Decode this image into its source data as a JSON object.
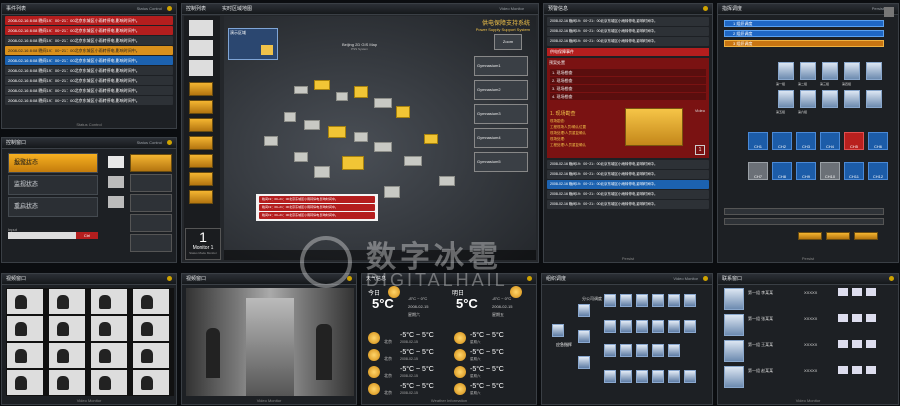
{
  "watermark": {
    "title": "数字冰雹",
    "subtitle": "DIGITALHAIL"
  },
  "alarm_panel": {
    "title": "事件列表",
    "sub": "Status Control",
    "footer": "Status Control",
    "rows": [
      {
        "text": "2008-02-16  8:08  晚间19：00~21：00北京东城区小雨转停电,影响时间中。",
        "style": "red"
      },
      {
        "text": "2008-02-16  8:08  晚间19：00~21：00北京东城区小雨转停电,影响时间中。",
        "style": "red"
      },
      {
        "text": "2008-02-16  8:08  晚间19：00~21：00北京东城区小雨转停电,影响时间中。",
        "style": "gray"
      },
      {
        "text": "2008-02-16  8:08  晚间19：00~21：00北京东城区小雨转停电,影响时间中。",
        "style": "orange"
      },
      {
        "text": "2008-02-16  8:08  晚间19：00~21：00北京东城区小雨转停电,影响时间中。",
        "style": "blue"
      },
      {
        "text": "2008-02-16  8:08  晚间19：00~21：00北京东城区小雨转停电,影响时间中。",
        "style": "gray"
      },
      {
        "text": "2008-02-16  8:08  晚间19：00~21：00北京东城区小雨转停电,影响时间中。",
        "style": "gray"
      },
      {
        "text": "2008-02-16  8:08  晚间19：00~21：00北京东城区小雨转停电,影响时间中。",
        "style": "gray"
      },
      {
        "text": "2008-02-16  8:08  晚间19：00~21：00北京东城区小雨转停电,影响时间中。",
        "style": "gray"
      }
    ]
  },
  "control_panel": {
    "title": "控制窗口",
    "sub": "Status Control",
    "footer": "Status Control",
    "states": [
      {
        "label": "报警状态",
        "sub": "Alarm Status"
      },
      {
        "label": "监视状态",
        "sub": "Camera Status"
      },
      {
        "label": "重启状态",
        "sub": "System Status"
      }
    ],
    "input_label": "Input",
    "input_value": "Ctrl"
  },
  "map_panel": {
    "title": "控制列表",
    "monitor_number": "1",
    "monitor_label": "Monitor 1",
    "monitor_sub": "Status Mode Monitor",
    "main_title": "供电保障支持系统",
    "main_sub": "Power Supply Support System",
    "header_left": "实时区域地图",
    "mini_label": "演示区域",
    "city_label": "Beijing 2D GIS Map",
    "city_sub": "PSS System",
    "zoom": "Zoom",
    "venues": [
      "Gymnasium1",
      "Gymnasium2",
      "Gymnasium3",
      "Gymnasium4",
      "Gymnasium5"
    ],
    "ticker": [
      "晚间19：00~21：00北京东城区小雨转停电,影响时间中。",
      "晚间19：00~21：00北京东城区小雨转停电,影响时间中。",
      "晚间19：00~21：00北京东城区小雨转停电,影响时间中。"
    ],
    "footer": "Video Monitor"
  },
  "alert_panel": {
    "title": "预警信息",
    "rows": [
      "2008-02-16  晚间19：00~21：00北京东城区小雨转停电,影响时间中。",
      "2008-02-16  晚间19：00~21：00北京东城区小雨转停电,影响时间中。",
      "2008-02-16  晚间19：00~21：00北京东城区小雨转停电,影响时间中。"
    ],
    "event_title": "供电保障事件",
    "plan_title": "预案处置",
    "plans": [
      "1. 现场勘查",
      "2. 现场勘查",
      "3. 现场勘查",
      "4. 现场勘查"
    ],
    "detail_title": "1. 现场勘查",
    "detail_lines": [
      "现场勘查:",
      "工程现场人员/确认位置",
      "现场处理/人员重复确认",
      "现场处理:",
      "工程处理/人员重复确认"
    ],
    "detail_tag": "Video",
    "page": "1",
    "bottom_rows": [
      "2008-02-16  晚间19：00~21：00北京东城区小雨转停电,影响时间中。",
      "2008-02-16  晚间19：00~21：00北京东城区小雨转停电,影响时间中。",
      "2008-02-16  晚间19：00~21：00北京东城区小雨转停电,影响时间中。",
      "2008-02-16  晚间19：00~21：00北京东城区小雨转停电,影响时间中。",
      "2008-02-16  晚间19：00~21：00北京东城区小雨转停电,影响时间中。"
    ],
    "footer": "Persist"
  },
  "staff_panel": {
    "title": "指挥调度",
    "sub": "Persist",
    "groups": [
      "1 组织调度",
      "2 组织调度",
      "3 组织调度"
    ],
    "people": [
      "第一组",
      "第二组",
      "第三组",
      "第四组",
      "第五组",
      "第六组"
    ],
    "tiles": [
      "CH1",
      "CH2",
      "CH3",
      "CH4",
      "CH5",
      "CH6",
      "CH7",
      "CH8",
      "CH9",
      "CH10",
      "CH11",
      "CH12"
    ],
    "footer": "Persist"
  },
  "video_panel_1": {
    "title": "视频窗口",
    "footer": "Video Monitor"
  },
  "video_panel_2": {
    "title": "视频窗口",
    "footer": "Video Monitor"
  },
  "weather_panel": {
    "title": "天气信息",
    "today": {
      "label": "今日",
      "temp": "5°C",
      "range": "-8°C ~ 0°C",
      "date": "2008-02-15",
      "weekday": "星期六"
    },
    "tomorrow": {
      "label": "明日",
      "temp": "5°C",
      "range": "-8°C ~ 0°C",
      "date": "2008-02-15",
      "weekday": "星期五"
    },
    "rows": [
      {
        "city": "北京",
        "temp": "-5°C ~ 5°C",
        "date": "2008-02-15",
        "weekday": "星期六"
      },
      {
        "city": "北京",
        "temp": "-5°C ~ 5°C",
        "date": "2008-02-15",
        "weekday": "星期六"
      },
      {
        "city": "北京",
        "temp": "-5°C ~ 5°C",
        "date": "2008-02-15",
        "weekday": "星期六"
      },
      {
        "city": "北京",
        "temp": "-5°C ~ 5°C",
        "date": "2008-02-15",
        "weekday": "星期六"
      }
    ],
    "footer": "Weather Information"
  },
  "org_panel": {
    "title": "组织调度",
    "center": "应急指挥",
    "sub": "分公司调度",
    "footer": "Video Monitor"
  },
  "contact_panel": {
    "title": "联系窗口",
    "rows": [
      {
        "name": "第一组 李某某",
        "tel": "XXXXX"
      },
      {
        "name": "第一组 张某某",
        "tel": "XXXXX"
      },
      {
        "name": "第一组 王某某",
        "tel": "XXXXX"
      },
      {
        "name": "第一组 赵某某",
        "tel": "XXXXX"
      }
    ],
    "footer": "Video Monitor"
  }
}
